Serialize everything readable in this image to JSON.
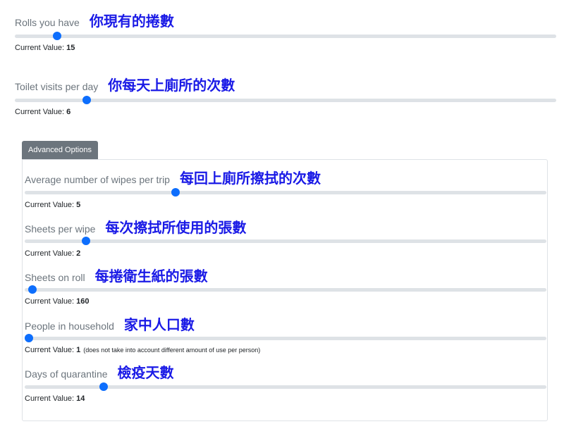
{
  "sliders": [
    {
      "label": "Rolls you have",
      "chinese": "你現有的捲數",
      "cv_label": "Current Value:",
      "value": "15",
      "note": "",
      "fraction": 0.078
    },
    {
      "label": "Toilet visits per day",
      "chinese": "你每天上廁所的次數",
      "cv_label": "Current Value:",
      "value": "6",
      "note": "",
      "fraction": 0.133
    }
  ],
  "advanced": {
    "button_label": "Advanced Options",
    "sliders": [
      {
        "label": "Average number of wipes per trip",
        "chinese": "每回上廁所擦拭的次數",
        "cv_label": "Current Value:",
        "value": "5",
        "note": "",
        "fraction": 0.289
      },
      {
        "label": "Sheets per wipe",
        "chinese": "每次擦拭所使用的張數",
        "cv_label": "Current Value:",
        "value": "2",
        "note": "",
        "fraction": 0.117
      },
      {
        "label": "Sheets on roll",
        "chinese": "每捲衛生紙的張數",
        "cv_label": "Current Value:",
        "value": "160",
        "note": "",
        "fraction": 0.015
      },
      {
        "label": "People in household",
        "chinese": "家中人口數",
        "cv_label": "Current Value:",
        "value": "1",
        "note": "(does not take into account different amount of use per person)",
        "fraction": 0.008
      },
      {
        "label": "Days of quarantine",
        "chinese": "檢疫天數",
        "cv_label": "Current Value:",
        "value": "14",
        "note": "",
        "fraction": 0.152
      }
    ]
  },
  "colors": {
    "accent": "#0d6efd",
    "track": "#dee2e6",
    "button": "#6c757d",
    "annotation": "#1a1ae6"
  }
}
